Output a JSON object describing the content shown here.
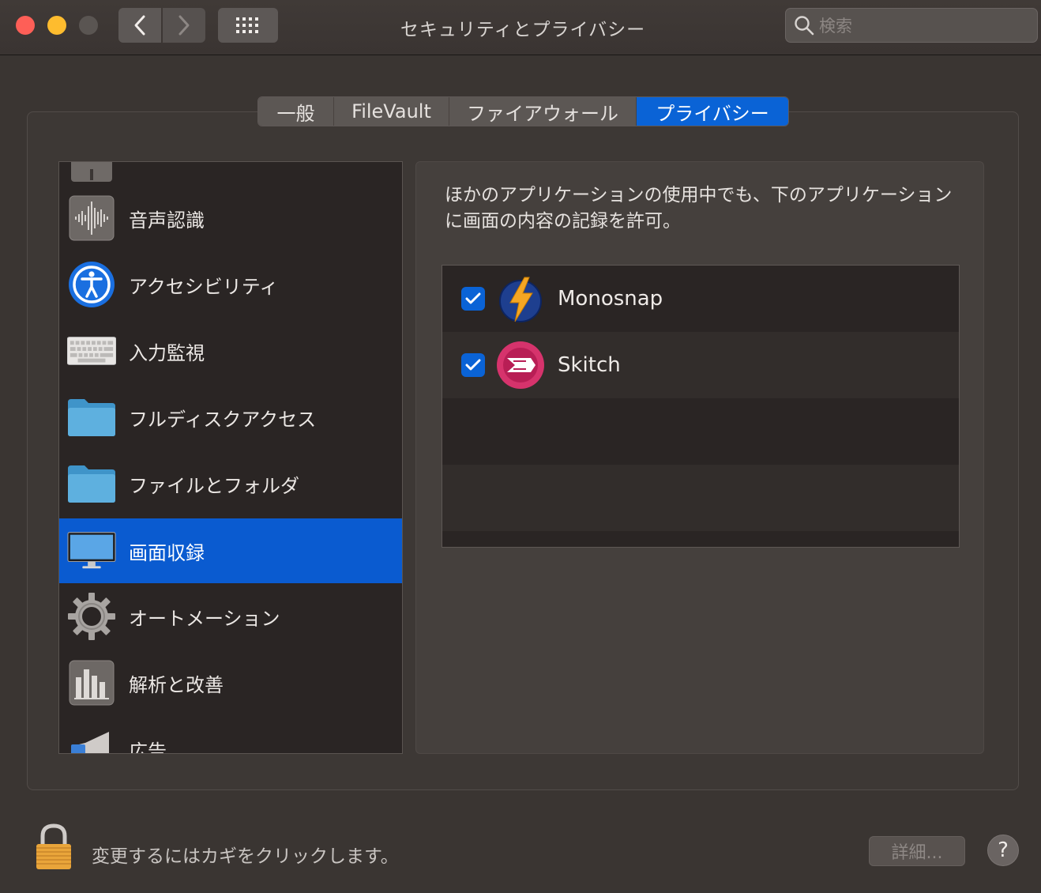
{
  "window": {
    "title": "セキュリティとプライバシー",
    "search_placeholder": "検索"
  },
  "tabs": [
    {
      "label": "一般",
      "active": false
    },
    {
      "label": "FileVault",
      "active": false
    },
    {
      "label": "ファイアウォール",
      "active": false
    },
    {
      "label": "プライバシー",
      "active": true
    }
  ],
  "sidebar": {
    "items": [
      {
        "label": "",
        "icon": "partial-icon"
      },
      {
        "label": "音声認識",
        "icon": "speech-recognition-icon"
      },
      {
        "label": "アクセシビリティ",
        "icon": "accessibility-icon"
      },
      {
        "label": "入力監視",
        "icon": "keyboard-icon"
      },
      {
        "label": "フルディスクアクセス",
        "icon": "folder-icon"
      },
      {
        "label": "ファイルとフォルダ",
        "icon": "folder-icon"
      },
      {
        "label": "画面収録",
        "icon": "display-icon",
        "selected": true
      },
      {
        "label": "オートメーション",
        "icon": "gear-icon"
      },
      {
        "label": "解析と改善",
        "icon": "bar-chart-icon"
      },
      {
        "label": "広告",
        "icon": "megaphone-icon"
      }
    ]
  },
  "detail": {
    "description": "ほかのアプリケーションの使用中でも、下のアプリケーションに画面の内容の記録を許可。",
    "apps": [
      {
        "name": "Monosnap",
        "checked": true,
        "icon": "monosnap-icon"
      },
      {
        "name": "Skitch",
        "checked": true,
        "icon": "skitch-icon"
      }
    ]
  },
  "footer": {
    "lock_text": "変更するにはカギをクリックします。",
    "details_label": "詳細...",
    "help_label": "?"
  },
  "colors": {
    "accent": "#0a63d6",
    "close": "#fe5f57",
    "minimize": "#febc2e"
  }
}
